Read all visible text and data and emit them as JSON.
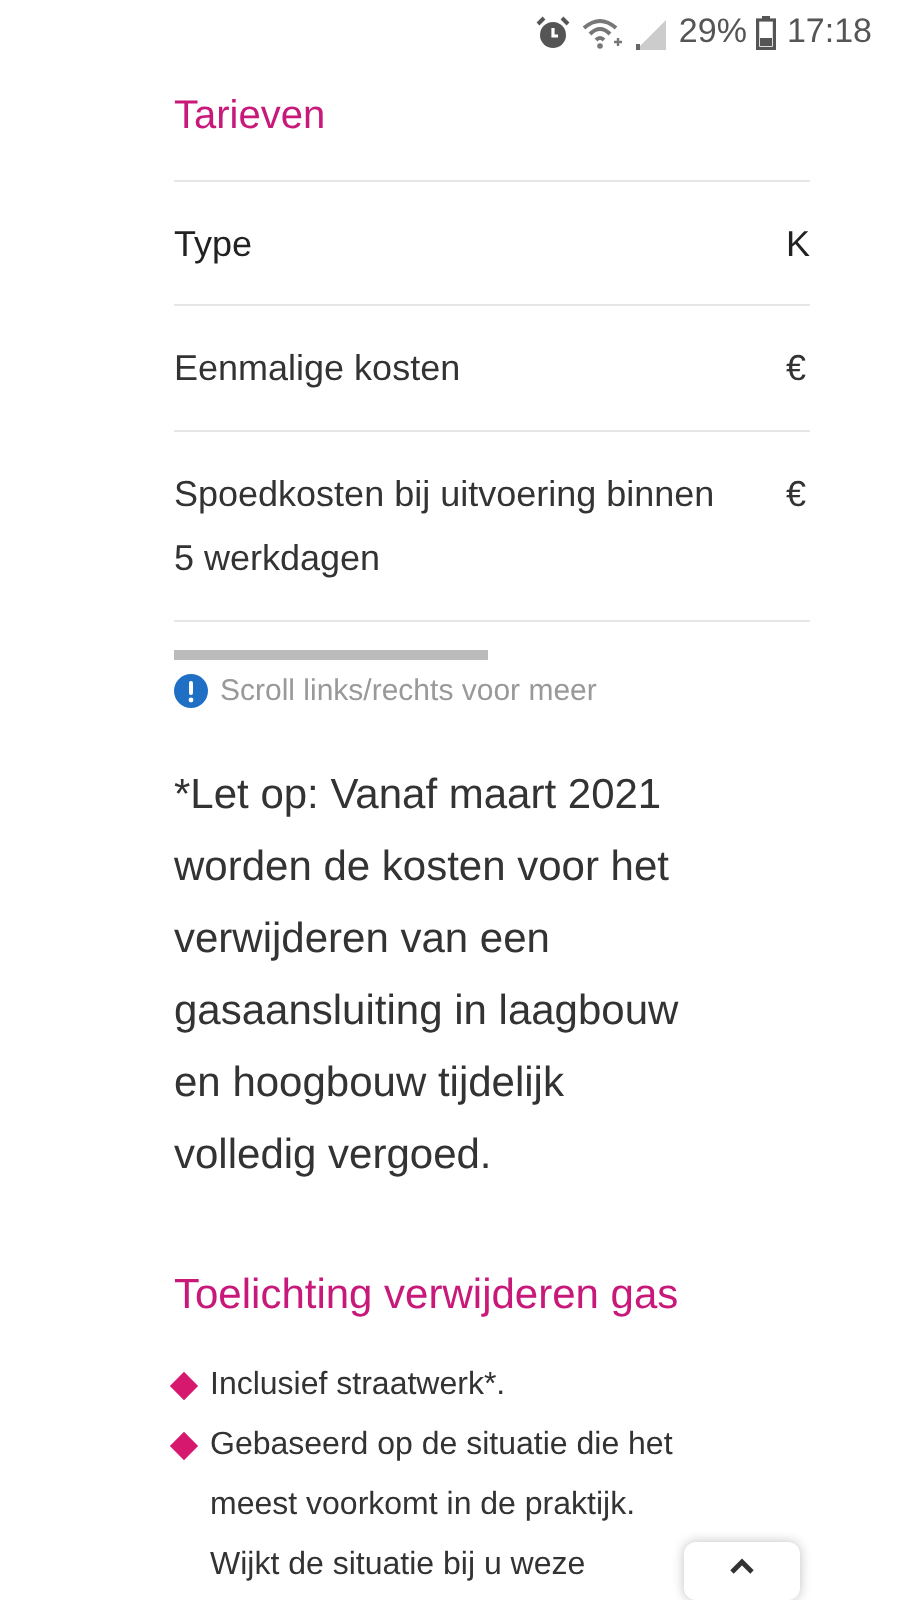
{
  "status_bar": {
    "battery": "29%",
    "time": "17:18"
  },
  "tariffs": {
    "title": "Tarieven",
    "columns": [
      "Type",
      "K"
    ],
    "rows": [
      {
        "cells": [
          "Eenmalige kosten",
          "€"
        ]
      },
      {
        "cells": [
          "Spoedkosten bij uitvoering binnen 5 werkdagen",
          "€"
        ]
      }
    ],
    "scroll_hint": "Scroll links/rechts voor meer"
  },
  "note": "*Let op: Vanaf maart 2021 worden de kosten voor het verwijderen van een gasaansluiting in laagbouw en hoogbouw tijdelijk volledig vergoed.",
  "explanation": {
    "title": "Toelichting verwijderen gas",
    "items": [
      "Inclusief straatwerk*.",
      "Gebaseerd op de situatie die het meest voorkomt in de praktijk. Wijkt de situatie bij u weze"
    ]
  }
}
